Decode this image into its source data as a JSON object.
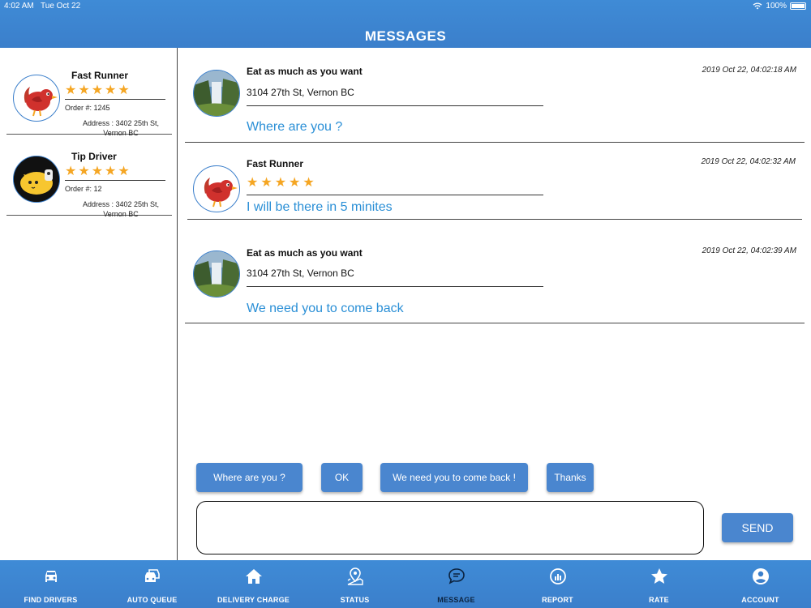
{
  "status_bar": {
    "time": "4:02 AM",
    "date": "Tue Oct 22",
    "battery": "100%"
  },
  "header": {
    "title": "MESSAGES"
  },
  "conversations": [
    {
      "name": "Fast Runner",
      "rating": "★★★★★",
      "order": "Order #: 1245",
      "address": "Address : 3402 25th St, Vernon BC",
      "avatar_icon": "red-bird-icon"
    },
    {
      "name": "Tip Driver",
      "rating": "★★★★★",
      "order": "Order #: 12",
      "address": "Address : 3402 25th St, Vernon BC",
      "avatar_icon": "yellow-cat-icon"
    }
  ],
  "messages": [
    {
      "sender": "Eat as much as you want",
      "address": "3104 27th St, Vernon BC",
      "text": "Where are you ?",
      "time": "2019 Oct 22, 04:02:18 AM",
      "avatar_icon": "waterfall-photo"
    },
    {
      "sender": "Fast Runner",
      "rating": "★★★★★",
      "text": "I will be there in  5 minites",
      "time": "2019 Oct 22, 04:02:32 AM",
      "avatar_icon": "red-bird-icon"
    },
    {
      "sender": "Eat as much as you want",
      "address": "3104 27th St, Vernon BC",
      "text": "We need you to come back",
      "time": "2019 Oct 22, 04:02:39 AM",
      "avatar_icon": "waterfall-photo"
    }
  ],
  "quick_replies": [
    "Where are you ?",
    "OK",
    "We need you to come back !",
    "Thanks"
  ],
  "composer": {
    "value": "",
    "send_label": "SEND"
  },
  "tabs": [
    {
      "label": "FIND DRIVERS",
      "icon": "car-icon"
    },
    {
      "label": "AUTO QUEUE",
      "icon": "cars-queue-icon"
    },
    {
      "label": "DELIVERY CHARGE",
      "icon": "home-icon"
    },
    {
      "label": "STATUS",
      "icon": "map-pin-icon"
    },
    {
      "label": "MESSAGE",
      "icon": "chat-bubble-icon",
      "active": true
    },
    {
      "label": "REPORT",
      "icon": "report-chart-icon"
    },
    {
      "label": "RATE",
      "icon": "star-icon"
    },
    {
      "label": "ACCOUNT",
      "icon": "account-icon"
    }
  ],
  "colors": {
    "accent": "#3b7fcb",
    "star": "#f5a623",
    "message_text": "#2a8fd6",
    "active_tab": "#0c2340"
  }
}
